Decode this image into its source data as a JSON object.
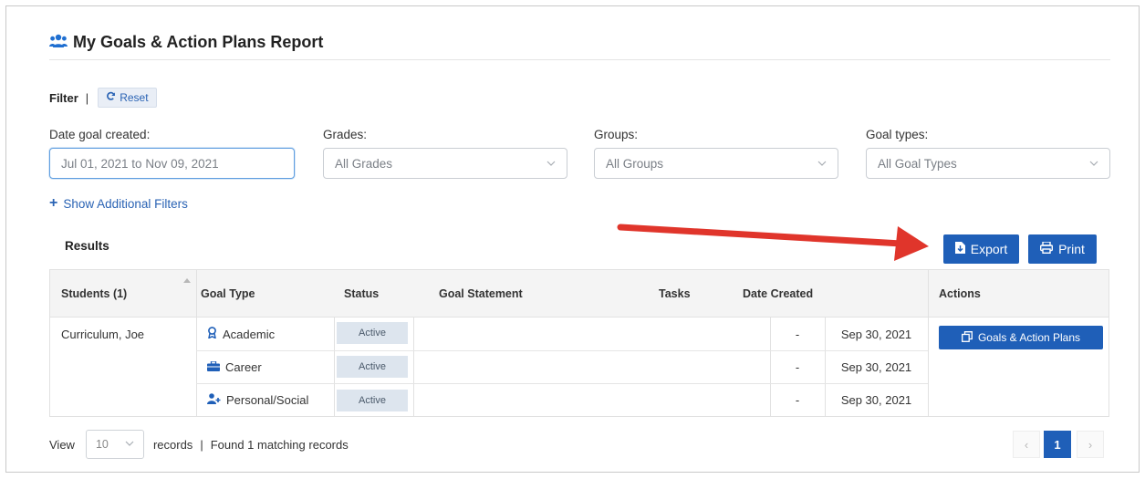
{
  "header": {
    "title": "My Goals & Action Plans Report",
    "icon": "users-icon"
  },
  "filter": {
    "label": "Filter",
    "separator": "|",
    "reset_label": "Reset"
  },
  "fields": {
    "date": {
      "label": "Date goal created:",
      "value": "Jul 01, 2021 to Nov 09, 2021"
    },
    "grades": {
      "label": "Grades:",
      "value": "All Grades"
    },
    "groups": {
      "label": "Groups:",
      "value": "All Groups"
    },
    "goal_types": {
      "label": "Goal types:",
      "value": "All Goal Types"
    }
  },
  "additional_filters": "Show Additional Filters",
  "results": {
    "label": "Results",
    "export_label": "Export",
    "print_label": "Print"
  },
  "table": {
    "headers": [
      "Students (1)",
      "Goal Type",
      "Status",
      "Goal Statement",
      "Tasks",
      "Date Created",
      "Actions"
    ],
    "student": "Curriculum, Joe",
    "rows": [
      {
        "goal_type": "Academic",
        "icon": "academic-icon",
        "status": "Active",
        "tasks": "-",
        "date": "Sep 30, 2021"
      },
      {
        "goal_type": "Career",
        "icon": "briefcase-icon",
        "status": "Active",
        "tasks": "-",
        "date": "Sep 30, 2021"
      },
      {
        "goal_type": "Personal/Social",
        "icon": "user-plus-icon",
        "status": "Active",
        "tasks": "-",
        "date": "Sep 30, 2021"
      }
    ],
    "action_label": "Goals & Action Plans"
  },
  "footer": {
    "view_label": "View",
    "records_per_page": "10",
    "records_label": "records",
    "separator": "|",
    "found_text": "Found 1 matching records"
  },
  "pagination": {
    "prev": "‹",
    "current": "1",
    "next": "›"
  },
  "colors": {
    "primary": "#1f5fb8",
    "link": "#2a63b4",
    "arrow": "#e0352b"
  }
}
